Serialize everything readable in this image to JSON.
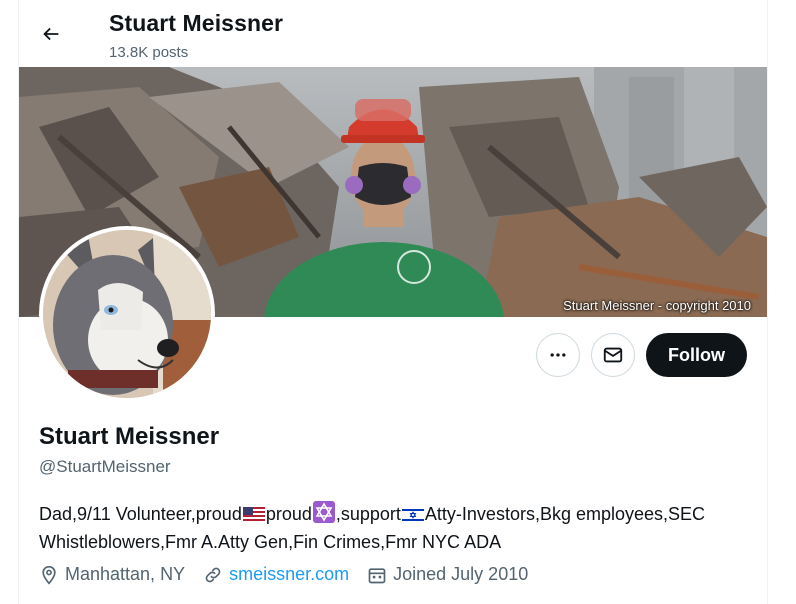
{
  "header": {
    "name": "Stuart Meissner",
    "posts": "13.8K posts"
  },
  "banner": {
    "credit": "Stuart Meissner - copyright 2010"
  },
  "actions": {
    "follow_label": "Follow"
  },
  "profile": {
    "display_name": "Stuart Meissner",
    "handle": "@StuartMeissner",
    "bio": {
      "part1": "Dad,9/11 Volunteer,proud",
      "part2": "proud",
      "part3": ",support",
      "part4": "Atty-Investors,Bkg employees,SEC Whistleblowers,Fmr A.Atty Gen,Fin Crimes,Fmr NYC ADA"
    },
    "location": "Manhattan, NY",
    "website": "smeissner.com",
    "joined": "Joined July 2010"
  },
  "icons": {
    "back": "arrow-left-icon",
    "more": "more-dots-icon",
    "message": "envelope-icon",
    "location": "location-pin-icon",
    "link": "link-icon",
    "calendar": "calendar-icon",
    "flag_us": "us-flag-emoji",
    "star_of_david": "star-of-david-emoji",
    "flag_israel": "israel-flag-emoji"
  },
  "colors": {
    "link": "#1d9bf0",
    "secondary_text": "#536471",
    "follow_bg": "#0f1419"
  }
}
